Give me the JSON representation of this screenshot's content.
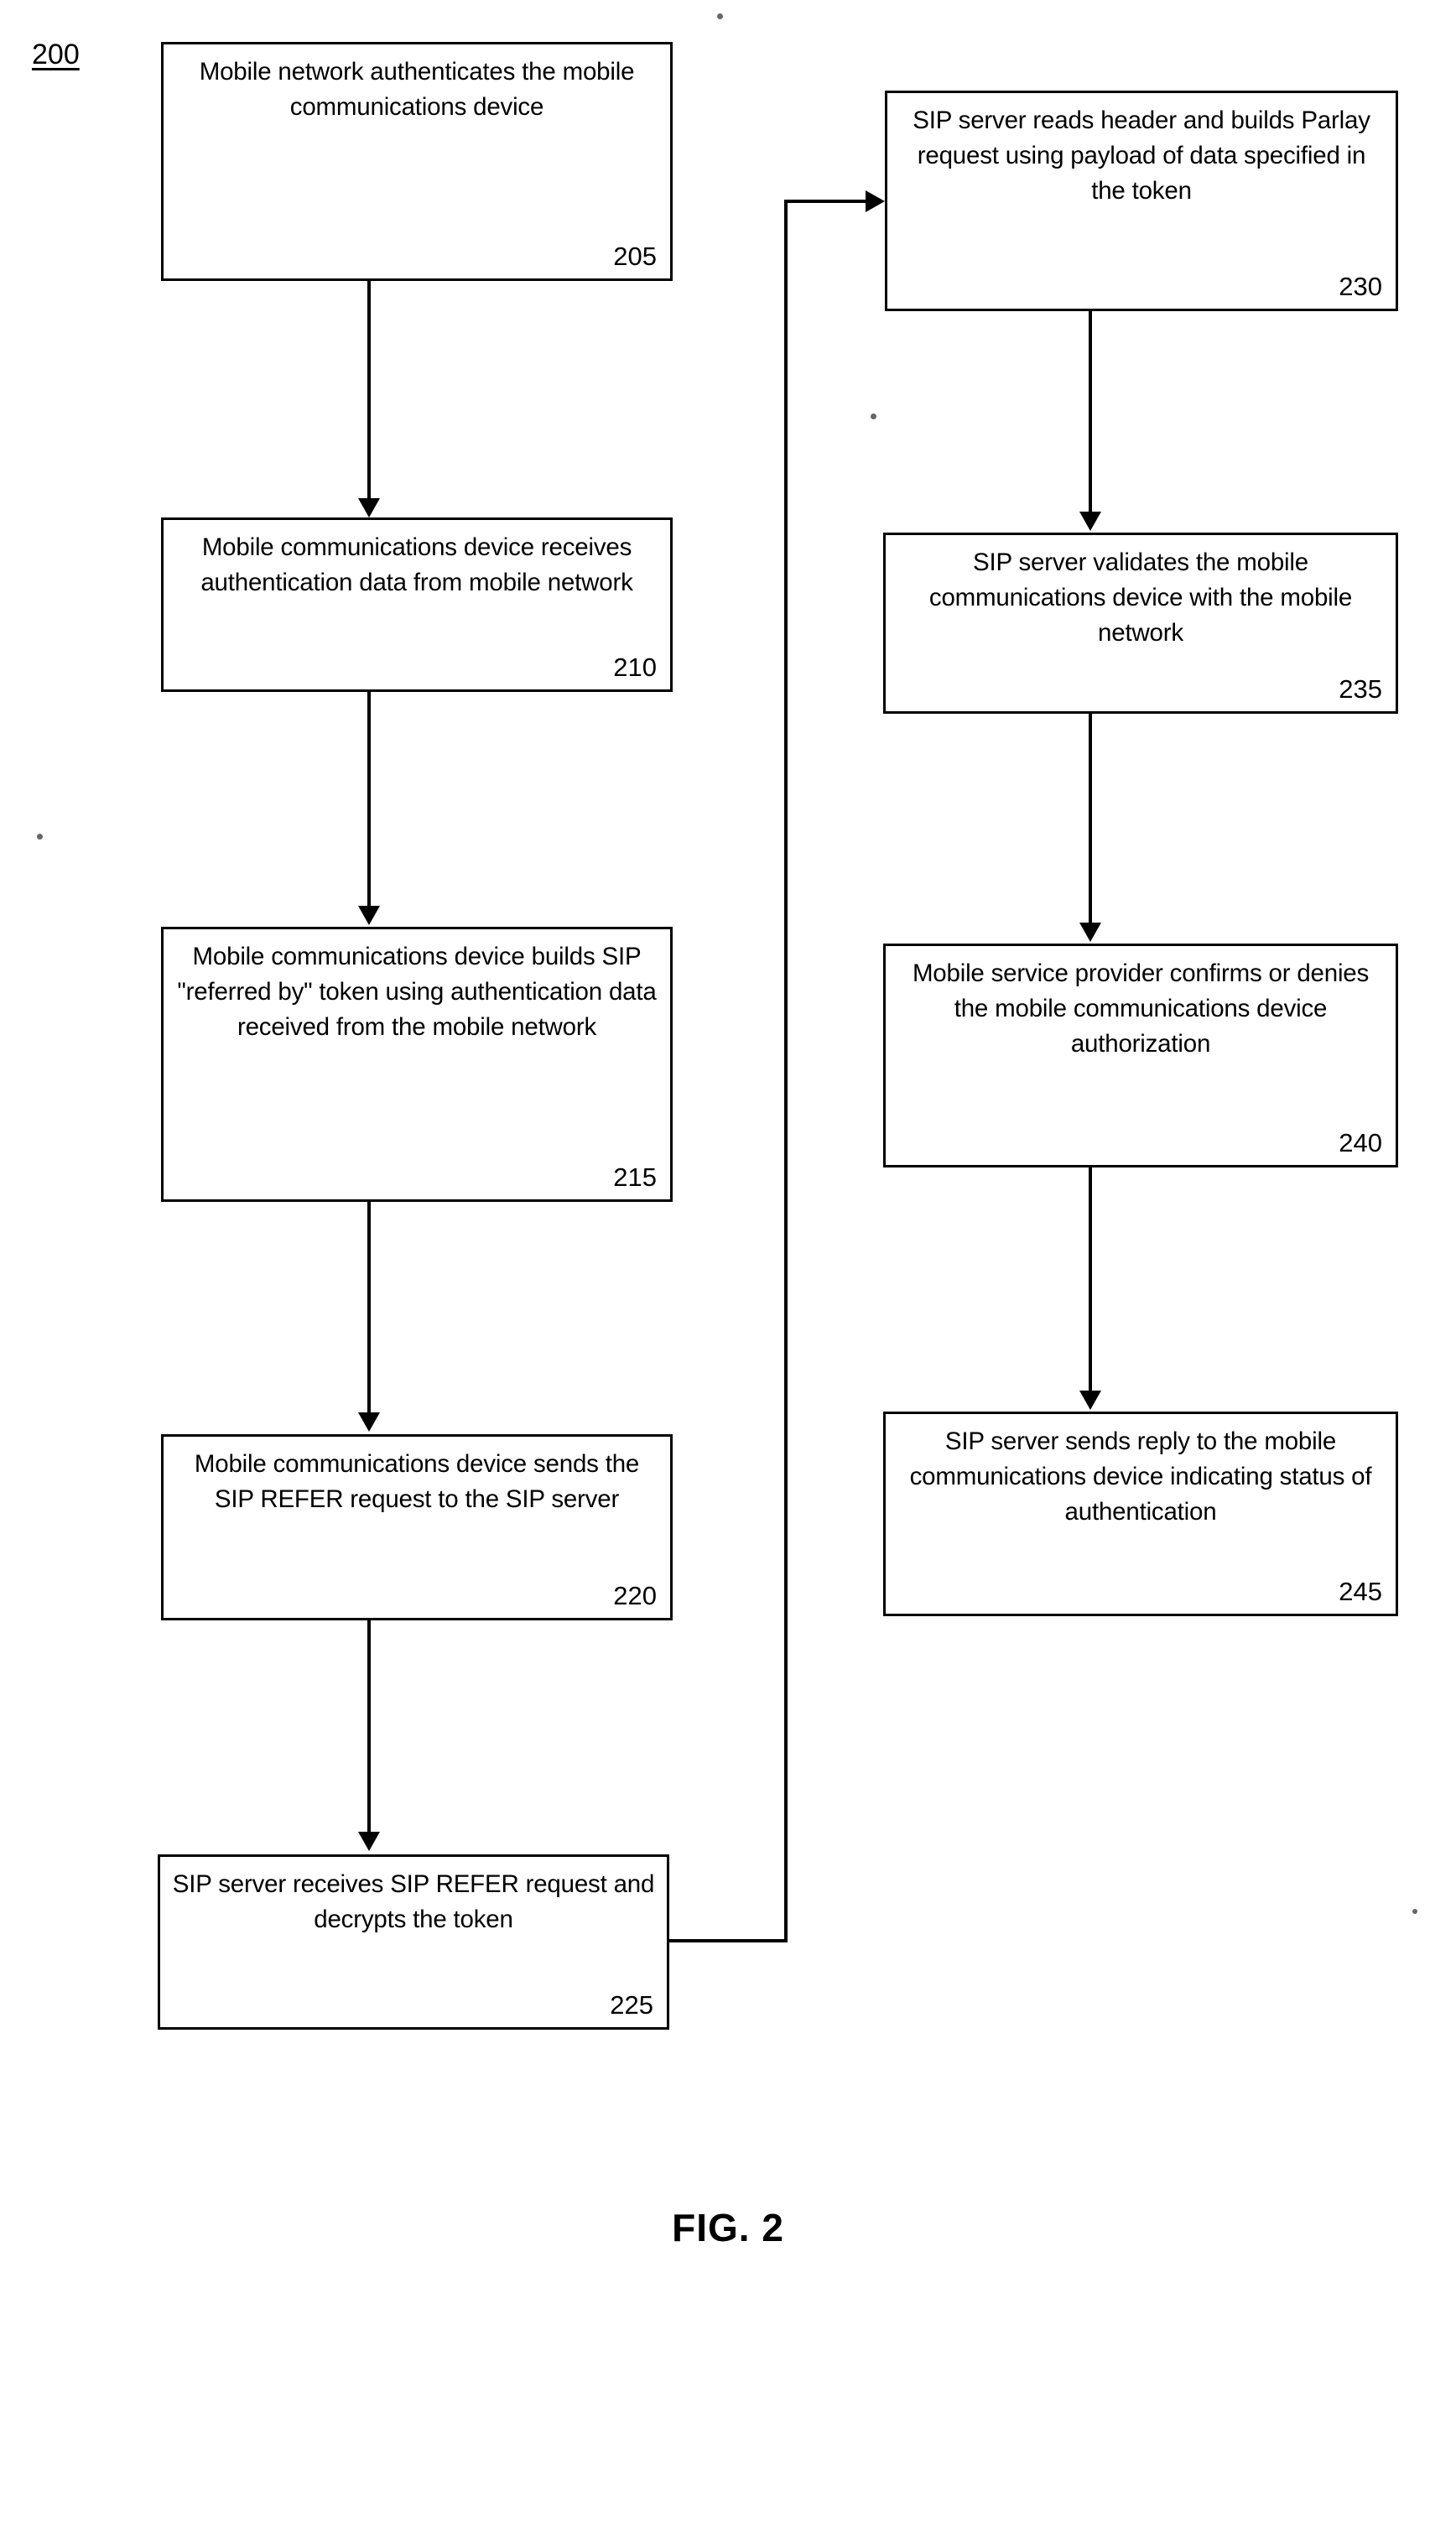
{
  "figure": {
    "number_label": "200",
    "caption": "FIG. 2"
  },
  "colors": {
    "stroke": "#000000",
    "background": "#ffffff"
  },
  "nodes": [
    {
      "id": "205",
      "ref": "205",
      "text": "Mobile network authenticates the mobile communications device"
    },
    {
      "id": "210",
      "ref": "210",
      "text": "Mobile communications device receives authentication data from mobile network"
    },
    {
      "id": "215",
      "ref": "215",
      "text": "Mobile communications device builds SIP \"referred by\" token using authentication data received from the mobile network"
    },
    {
      "id": "220",
      "ref": "220",
      "text": "Mobile communications device sends the SIP REFER request to the SIP server"
    },
    {
      "id": "225",
      "ref": "225",
      "text": "SIP server receives SIP REFER request and decrypts the token"
    },
    {
      "id": "230",
      "ref": "230",
      "text": "SIP server reads header and builds Parlay request using payload of data specified in the token"
    },
    {
      "id": "235",
      "ref": "235",
      "text": "SIP server validates the mobile communications device with the mobile network"
    },
    {
      "id": "240",
      "ref": "240",
      "text": "Mobile service provider confirms or denies the mobile communications device authorization"
    },
    {
      "id": "245",
      "ref": "245",
      "text": "SIP server sends reply to the mobile communications device indicating status of authentication"
    }
  ],
  "connectors": [
    {
      "name": "205-to-210",
      "from": "205",
      "to": "210",
      "kind": "arrow-down"
    },
    {
      "name": "210-to-215",
      "from": "210",
      "to": "215",
      "kind": "arrow-down"
    },
    {
      "name": "215-to-220",
      "from": "215",
      "to": "220",
      "kind": "arrow-down"
    },
    {
      "name": "220-to-225",
      "from": "220",
      "to": "225",
      "kind": "arrow-down"
    },
    {
      "name": "225-to-230",
      "from": "225",
      "to": "230",
      "kind": "elbow-arrow-right"
    },
    {
      "name": "230-to-235",
      "from": "230",
      "to": "235",
      "kind": "arrow-down"
    },
    {
      "name": "235-to-240",
      "from": "235",
      "to": "240",
      "kind": "arrow-down"
    },
    {
      "name": "240-to-245",
      "from": "240",
      "to": "245",
      "kind": "arrow-down"
    }
  ]
}
